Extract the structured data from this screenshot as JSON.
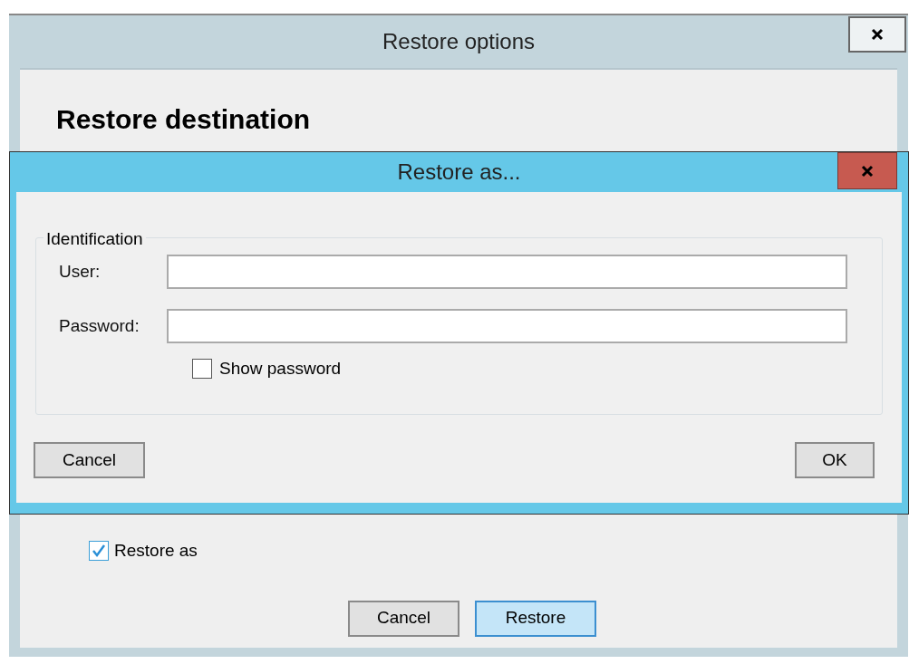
{
  "window": {
    "title": "Restore options",
    "heading": "Restore destination",
    "restore_as": {
      "label": "Restore as",
      "checked": true
    },
    "buttons": [
      {
        "label": "Cancel",
        "kind": "normal"
      },
      {
        "label": "Restore",
        "kind": "default"
      }
    ]
  },
  "dialog": {
    "title": "Restore as...",
    "group": {
      "title": "Identification",
      "fields": [
        {
          "label": "User:"
        },
        {
          "label": "Password:"
        }
      ],
      "show_password": {
        "label": "Show password",
        "checked": false
      }
    },
    "buttons": [
      {
        "label": "Cancel"
      },
      {
        "label": "OK"
      }
    ]
  }
}
